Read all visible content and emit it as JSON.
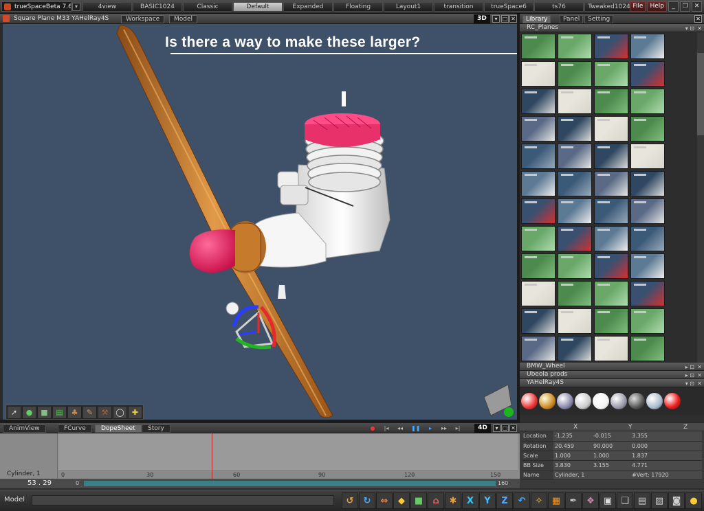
{
  "app": {
    "title": "trueSpaceBeta 7.6"
  },
  "layout_tabs": [
    "4view",
    "BASIC1024",
    "Classic",
    "Default",
    "Expanded",
    "Floating",
    "Layout1",
    "transition",
    "trueSpace6",
    "ts76",
    "Tweaked1024"
  ],
  "top_buttons": {
    "file": "File",
    "help": "Help"
  },
  "viewport": {
    "title": "Square Plane M33 YAHelRay4S",
    "tabs": [
      "Workspace",
      "Model"
    ],
    "mode": "3D",
    "annotation": "Is there a way to make these larger?"
  },
  "library": {
    "tabs": [
      "Library",
      "Panel",
      "Setting"
    ],
    "sections": {
      "rc_planes": "RC_Planes",
      "bmw_wheel": "BMW_Wheel",
      "ubeola_prods": "Ubeola prods",
      "yahelray": "YAHelRay4S"
    }
  },
  "anim": {
    "tabs": [
      "AnimView",
      "FCurve",
      "DopeSheet",
      "Story"
    ],
    "mode": "4D",
    "object_label": "Cylinder, 1",
    "frame": "53 . 29",
    "ruler": [
      "0",
      "30",
      "60",
      "90",
      "120",
      "150"
    ],
    "range_start": "0",
    "range_end": "160"
  },
  "props": {
    "cols": [
      "X",
      "Y",
      "Z"
    ],
    "rows": [
      {
        "label": "Location",
        "x": "-1.235",
        "y": "-0.015",
        "z": "3.355"
      },
      {
        "label": "Rotation",
        "x": "20.459",
        "y": "90.000",
        "z": "0.000"
      },
      {
        "label": "Scale",
        "x": "1.000",
        "y": "1.000",
        "z": "1.837"
      },
      {
        "label": "BB Size",
        "x": "3.830",
        "y": "3.155",
        "z": "4.771"
      }
    ],
    "name_label": "Name",
    "name_value": "Cylinder, 1",
    "vert_label": "#Vert: 17920"
  },
  "status": {
    "mode": "Model"
  },
  "colors": {
    "viewport_bg": "#3e5168",
    "accent": "#e8306a",
    "prop_wood": "#c57a2c"
  }
}
